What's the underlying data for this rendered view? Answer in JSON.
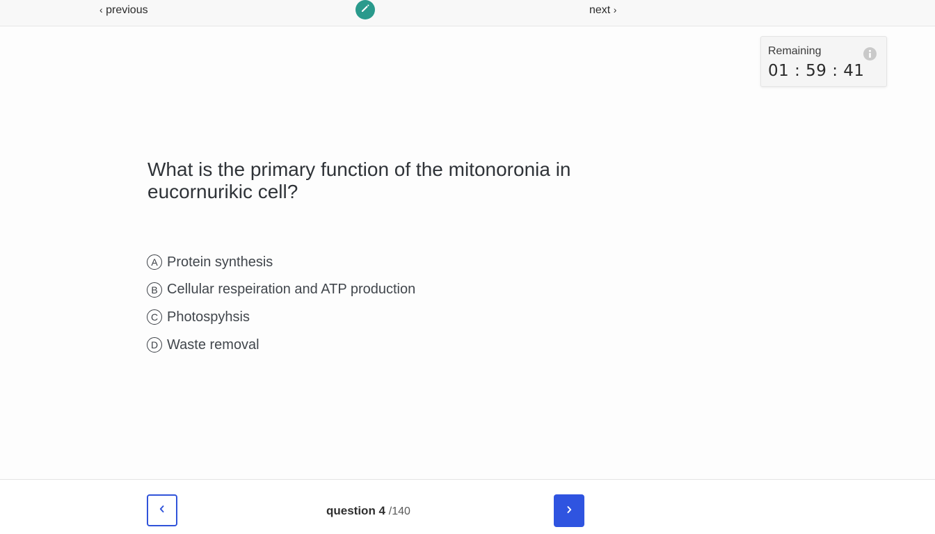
{
  "top_nav": {
    "previous_label": "previous",
    "next_label": "next",
    "edit_icon": "pencil-icon",
    "accent_color": "#2a9a8c"
  },
  "timer": {
    "label": "Remaining",
    "value": "01 : 59 : 41",
    "info_icon": "info-icon"
  },
  "question": {
    "text": "What is the primary function of the mitonoronia in eucornurikic cell?",
    "options": [
      {
        "letter": "A",
        "text": "Protein synthesis"
      },
      {
        "letter": "B",
        "text": "Cellular respeiration and ATP production"
      },
      {
        "letter": "C",
        "text": "Photospyhsis"
      },
      {
        "letter": "D",
        "text": "Waste removal"
      }
    ]
  },
  "footer": {
    "question_label": "question 4",
    "question_total": "/140",
    "prev_icon": "chevron-left-icon",
    "next_icon": "chevron-right-icon",
    "button_color": "#2f54e0"
  }
}
